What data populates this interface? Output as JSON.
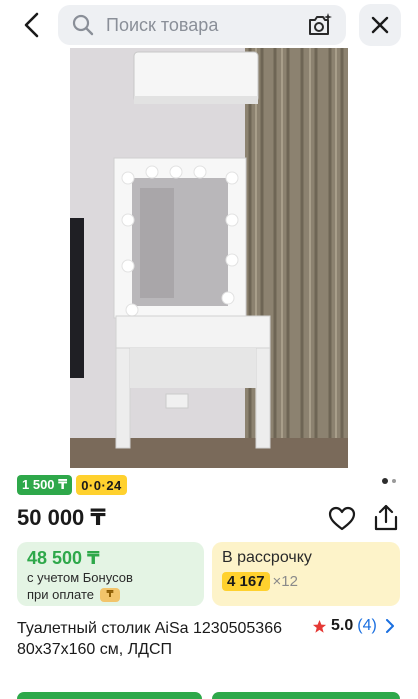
{
  "search": {
    "placeholder": "Поиск товара"
  },
  "icons": {
    "back": "back-arrow-icon",
    "search": "search-icon",
    "camera": "camera-search-icon",
    "close": "close-icon",
    "favorite": "heart-icon",
    "share": "share-icon",
    "star": "star-icon",
    "chevron": "chevron-right-icon"
  },
  "badges": {
    "bonus": "1 500 ₸",
    "installment": "0·0·24"
  },
  "gallery": {
    "current_index": 1,
    "total": 2
  },
  "price": "50 000 ₸",
  "bonus_card": {
    "price": "48 500 ₸",
    "line1": "с учетом Бонусов",
    "line2": "при оплате"
  },
  "installment_card": {
    "title": "В рассрочку",
    "monthly": "4 167",
    "months": "×12"
  },
  "product": {
    "title": "Туалетный столик AiSa 1230505366 80x37x160 см, ЛДСП"
  },
  "rating": {
    "value": "5.0",
    "count": "(4)"
  },
  "colors": {
    "green": "#2ea84a",
    "yellow": "#ffd12e",
    "link": "#1a6fe0",
    "star": "#e53935"
  }
}
